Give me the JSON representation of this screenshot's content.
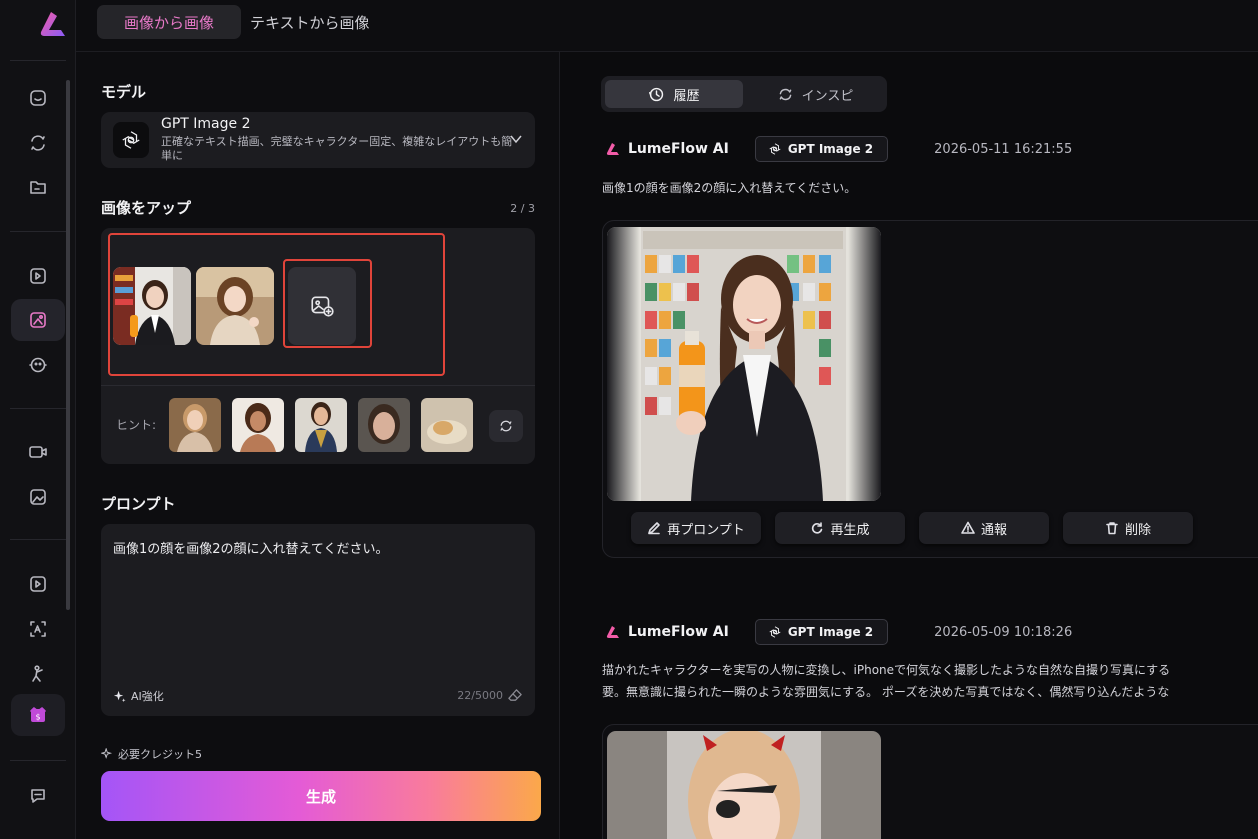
{
  "top_tabs": {
    "active": "画像から画像",
    "other": "テキストから画像"
  },
  "left": {
    "model_heading": "モデル",
    "model_name": "GPT Image 2",
    "model_desc": "正確なテキスト描画、完璧なキャラクター固定、複雑なレイアウトも簡単に",
    "upload_heading": "画像をアップ",
    "upload_count": "2 / 3",
    "hint_label": "ヒント:",
    "prompt_heading": "プロンプト",
    "prompt_text": "画像1の顔を画像2の顔に入れ替えてください。",
    "ai_enhance": "AI強化",
    "char_count": "22/5000",
    "credit": "必要クレジット5",
    "generate": "生成"
  },
  "right": {
    "tab_history": "履歴",
    "tab_inspi": "インスピ",
    "entries": [
      {
        "brand": "LumeFlow AI",
        "model": "GPT Image 2",
        "timestamp": "2026-05-11 16:21:55",
        "prompt": "画像1の顔を画像2の顔に入れ替えてください。"
      },
      {
        "brand": "LumeFlow AI",
        "model": "GPT Image 2",
        "timestamp": "2026-05-09 10:18:26",
        "prompt_line1": "描かれたキャラクターを実写の人物に変換し、iPhoneで何気なく撮影したような自然な自撮り写真にする",
        "prompt_line2": "要。無意識に撮られた一瞬のような雰囲気にする。 ポーズを決めた写真ではなく、偶然写り込んだような"
      }
    ],
    "actions": {
      "reprompt": "再プロンプト",
      "regenerate": "再生成",
      "report": "通報",
      "delete": "削除"
    }
  },
  "colors": {
    "accent": "#e879c8",
    "highlight": "#e0443a"
  }
}
